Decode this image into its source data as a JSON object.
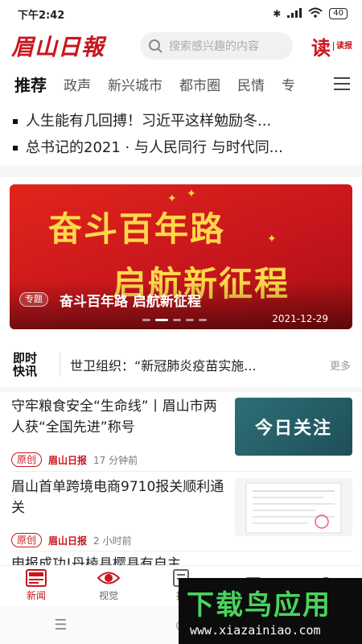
{
  "status": {
    "time": "下午2:42",
    "battery": "40"
  },
  "header": {
    "logo": "眉山日報",
    "search_placeholder": "搜索感兴趣的内容",
    "read_big": "读",
    "read_small": "读报"
  },
  "tabs": [
    "推荐",
    "政声",
    "新兴城市",
    "都市圈",
    "民情",
    "专"
  ],
  "headlines": [
    "人生能有几回搏！习近平这样勉励冬...",
    "总书记的2021 · 与人民同行 与时代同..."
  ],
  "banner": {
    "line1": "奋斗百年路",
    "line2": "启航新征程",
    "tag": "专题",
    "caption": "奋斗百年路 启航新征程",
    "date": "2021-12-29"
  },
  "quick": {
    "logo_line1": "即时",
    "logo_line2": "快讯",
    "text": "世卫组织：“新冠肺炎疫苗实施...",
    "more": "更多"
  },
  "news": [
    {
      "title": "守牢粮食安全“生命线”丨眉山市两人获“全国先进”称号",
      "badge": "原创",
      "source": "眉山日报",
      "time": "17 分钟前",
      "thumb_text": "今日关注"
    },
    {
      "title": "眉山首单跨境电商9710报关顺利通关",
      "badge": "原创",
      "source": "眉山日报",
      "time": "2 小时前"
    },
    {
      "title": "申报成功!丹棱县樱县有自主..."
    }
  ],
  "bottomnav": [
    "新闻",
    "视觉",
    "报",
    "",
    ""
  ],
  "watermark": {
    "title": "下载鸟应用",
    "url": "www.xiazainiao.com"
  },
  "colors": {
    "brand": "#c8161d",
    "banner_text": "#ffd84a"
  }
}
